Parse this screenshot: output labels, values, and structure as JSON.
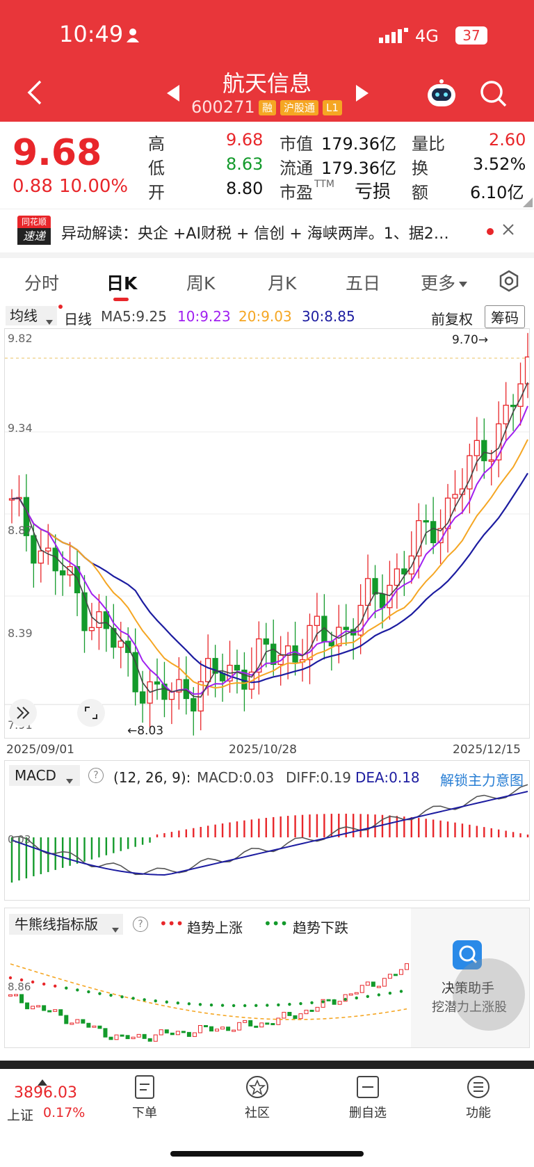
{
  "status_bar": {
    "time": "10:49",
    "network": "4G",
    "battery": "37"
  },
  "header": {
    "title": "航天信息",
    "code": "600271",
    "tags": [
      "融",
      "沪股通",
      "L1"
    ]
  },
  "quote": {
    "price": "9.68",
    "change": "0.88",
    "change_pct": "10.00%",
    "high_label": "高",
    "high": "9.68",
    "low_label": "低",
    "low": "8.63",
    "open_label": "开",
    "open": "8.80",
    "mcap_label": "市值",
    "mcap": "179.36亿",
    "float_label": "流通",
    "float": "179.36亿",
    "pe_label": "市盈",
    "pe_sup": "TTM",
    "pe": "亏损",
    "vr_label": "量比",
    "vr": "2.60",
    "turn_label": "换",
    "turn": "3.52%",
    "amt_label": "额",
    "amt": "6.10亿"
  },
  "news": {
    "brand_top": "同花顺",
    "brand_bottom": "速递",
    "text": "异动解读：央企 +AI财税 + 信创 + 海峡两岸。1、据2…"
  },
  "tabs": [
    "分时",
    "日K",
    "周K",
    "月K",
    "五日",
    "更多"
  ],
  "kline": {
    "ma_select": "均线",
    "period": "日线",
    "ma5": "MA5:9.25",
    "ma10": "10:9.23",
    "ma20": "20:9.03",
    "ma30": "30:8.85",
    "adjust": "前复权",
    "chip": "筹码",
    "y_ticks": [
      "9.82",
      "9.34",
      "8.87",
      "8.39",
      "7.91"
    ],
    "high_marker": "9.70→",
    "low_marker": "←8.03",
    "dates": [
      "2025/09/01",
      "2025/10/28",
      "2025/12/15"
    ],
    "colors": {
      "up": "#e8262a",
      "down": "#139a2b",
      "ma5": "#444444",
      "ma10": "#a020f0",
      "ma20": "#f5a623",
      "ma30": "#1c1ca0"
    }
  },
  "macd": {
    "select": "MACD",
    "params": "(12, 26, 9):",
    "macd": "MACD:0.03",
    "diff": "DIFF:0.19",
    "dea": "DEA:0.18",
    "unlock": "解锁主力意图",
    "zero": "0.03"
  },
  "bull": {
    "select": "牛熊线指标版",
    "up_dots": "•••",
    "up_label": "趋势上涨",
    "down_dots": "•••",
    "down_label": "趋势下跌",
    "tick": "8.86"
  },
  "assistant": {
    "title": "决策助手",
    "subtitle": "挖潜力上涨股"
  },
  "bottom_nav": {
    "index_value": "3896.03",
    "index_name": "上证",
    "index_pct": "0.17%",
    "items": [
      "下单",
      "社区",
      "删自选",
      "功能"
    ]
  }
}
